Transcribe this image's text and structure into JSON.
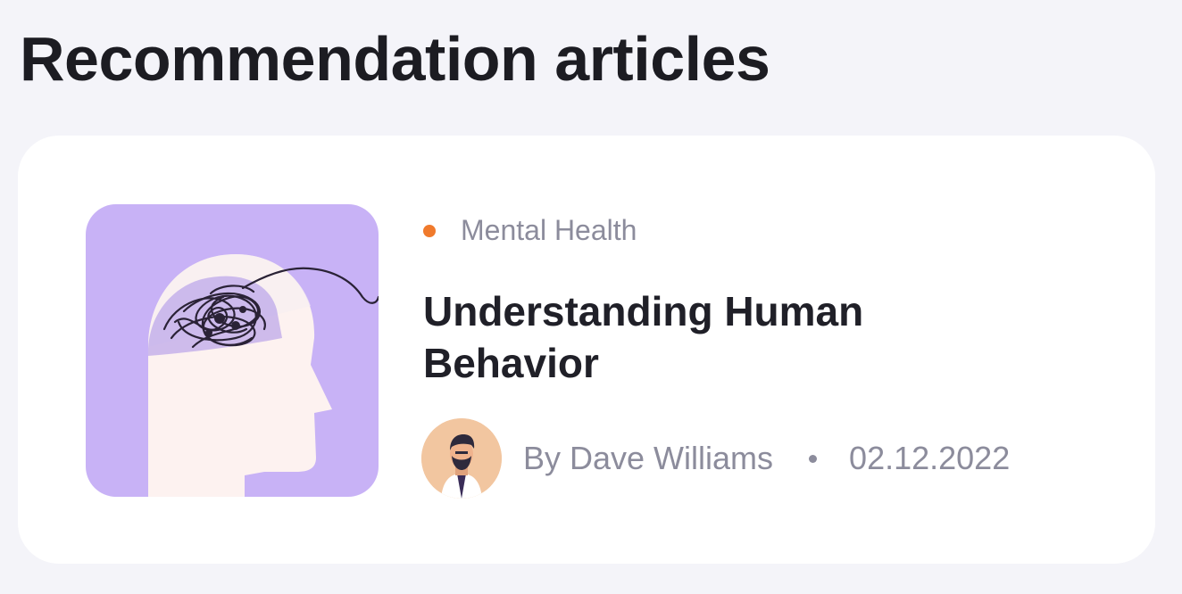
{
  "section": {
    "title": "Recommendation articles"
  },
  "article": {
    "category": "Mental Health",
    "title": "Understanding Human Behavior",
    "author": "By Dave Williams",
    "date": "02.12.2022",
    "thumbnail_icon": "head-with-tangled-thoughts-illustration",
    "avatar_icon": "author-avatar"
  },
  "colors": {
    "background": "#f4f4f9",
    "card": "#ffffff",
    "thumbnail": "#c8b2f6",
    "category_dot": "#f07a2c",
    "muted_text": "#8c8c9c",
    "title_text": "#202028"
  }
}
